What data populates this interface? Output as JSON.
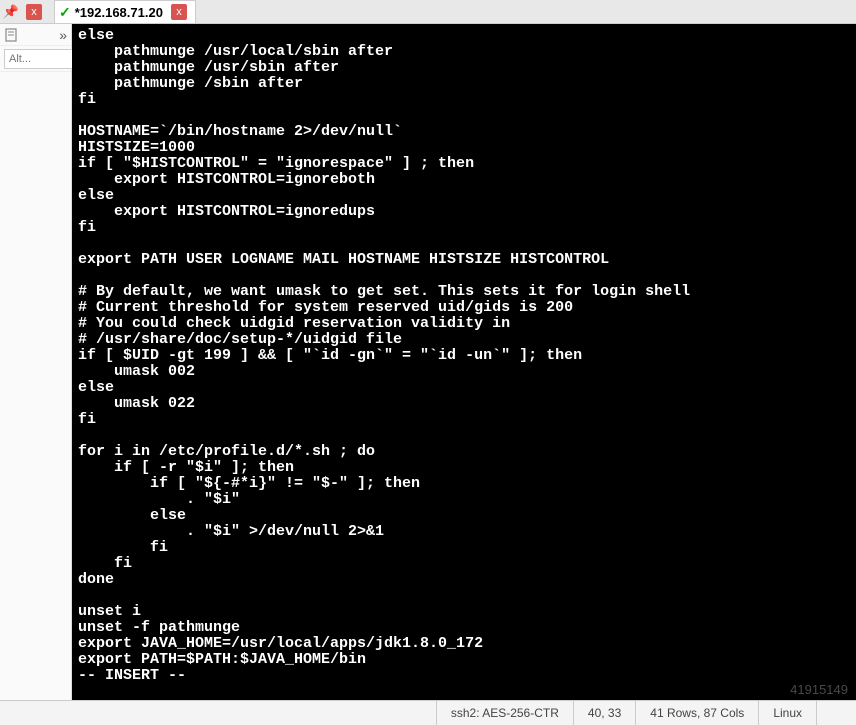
{
  "tab": {
    "title": "*192.168.71.20",
    "close_symbol": "x",
    "check_symbol": "✓"
  },
  "left_panel": {
    "pin_symbol": "📌",
    "chevrons": "»",
    "placeholder": "Alt...",
    "search_symbol": "🔍"
  },
  "terminal": {
    "content": "else\n    pathmunge /usr/local/sbin after\n    pathmunge /usr/sbin after\n    pathmunge /sbin after\nfi\n\nHOSTNAME=`/bin/hostname 2>/dev/null`\nHISTSIZE=1000\nif [ \"$HISTCONTROL\" = \"ignorespace\" ] ; then\n    export HISTCONTROL=ignoreboth\nelse\n    export HISTCONTROL=ignoredups\nfi\n\nexport PATH USER LOGNAME MAIL HOSTNAME HISTSIZE HISTCONTROL\n\n# By default, we want umask to get set. This sets it for login shell\n# Current threshold for system reserved uid/gids is 200\n# You could check uidgid reservation validity in\n# /usr/share/doc/setup-*/uidgid file\nif [ $UID -gt 199 ] && [ \"`id -gn`\" = \"`id -un`\" ]; then\n    umask 002\nelse\n    umask 022\nfi\n\nfor i in /etc/profile.d/*.sh ; do\n    if [ -r \"$i\" ]; then\n        if [ \"${-#*i}\" != \"$-\" ]; then\n            . \"$i\"\n        else\n            . \"$i\" >/dev/null 2>&1\n        fi\n    fi\ndone\n\nunset i\nunset -f pathmunge\nexport JAVA_HOME=/usr/local/apps/jdk1.8.0_172\nexport PATH=$PATH:$JAVA_HOME/bin",
    "mode": "-- INSERT --"
  },
  "status": {
    "protocol": "ssh2: AES-256-CTR",
    "cursor": "40, 33",
    "dims": "41 Rows, 87 Cols",
    "os": "Linux"
  },
  "watermark": "41915149"
}
